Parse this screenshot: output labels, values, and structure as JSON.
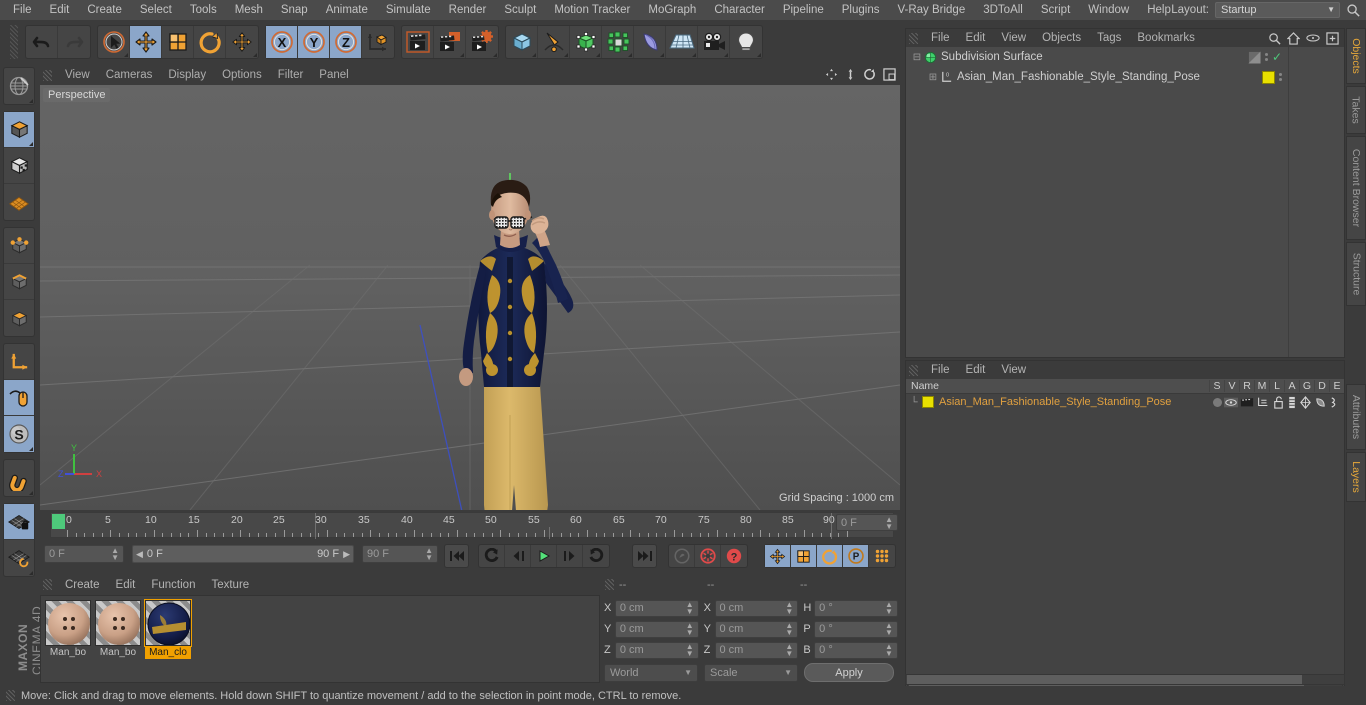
{
  "menubar": {
    "items": [
      "File",
      "Edit",
      "Create",
      "Select",
      "Tools",
      "Mesh",
      "Snap",
      "Animate",
      "Simulate",
      "Render",
      "Sculpt",
      "Motion Tracker",
      "MoGraph",
      "Character",
      "Pipeline",
      "Plugins",
      "V-Ray Bridge",
      "3DToAll",
      "Script",
      "Window",
      "Help"
    ],
    "layout_label": "Layout:",
    "layout_value": "Startup"
  },
  "toolbar": {
    "undo": "undo-arrow",
    "redo": "redo-arrow",
    "select": "selection-arrow",
    "move": "move-tool",
    "scale": "scale-tool",
    "rotate": "rotate-tool",
    "move2": "move-axis-tool",
    "axis_x": "X",
    "axis_y": "Y",
    "axis_z": "Z",
    "world_axis": "world-coordinate-system",
    "render_view": "render-view",
    "render_region": "render-region",
    "render_settings": "render-settings",
    "cube": "add-cube",
    "spline": "add-spline",
    "generator": "add-generator",
    "array": "add-array",
    "deformer": "add-deformer",
    "scene": "add-scene-object",
    "camera": "add-camera",
    "light": "add-light"
  },
  "left_toolbar": {
    "items": [
      "live-selection-globe-icon",
      "model-mode-icon",
      "texture-mode-icon",
      "polygon-grid-icon",
      "points-mode-icon",
      "edges-mode-icon",
      "polygons-mode-icon",
      "axis-mode-icon",
      "enable-axis-icon",
      "object-axis-icon",
      "magnet-icon",
      "workplane-lock-icon",
      "workplane-rotate-icon"
    ],
    "brand_line1": "MAXON",
    "brand_line2": "CINEMA 4D"
  },
  "viewport": {
    "menu": [
      "View",
      "Cameras",
      "Display",
      "Options",
      "Filter",
      "Panel"
    ],
    "perspective_label": "Perspective",
    "grid_spacing": "Grid Spacing : 1000 cm",
    "axis_x": "X",
    "axis_y": "Y",
    "axis_z": "Z",
    "icons": [
      "pan-icon",
      "zoom-icon",
      "rotate-icon",
      "maximize-icon"
    ]
  },
  "timeline": {
    "ticks": [
      "0",
      "5",
      "10",
      "15",
      "20",
      "25",
      "30",
      "35",
      "40",
      "45",
      "50",
      "55",
      "60",
      "65",
      "70",
      "75",
      "80",
      "85",
      "90"
    ],
    "current_frame_field": "0 F",
    "start_field": "0 F",
    "range_start": "0 F",
    "range_end": "90 F",
    "end_field": "90 F",
    "playback": [
      "go-to-start-icon",
      "play-backwards-icon",
      "step-back-icon",
      "play-icon",
      "step-forward-icon",
      "play-forward-icon",
      "go-to-end-icon"
    ],
    "record_tools": [
      "autokey-icon",
      "record-active-objects-icon",
      "record-help-icon"
    ],
    "key_tools": [
      "key-position-icon",
      "key-scale-icon",
      "key-rotation-icon",
      "key-parameter-icon",
      "key-point-icon",
      "animation-layer-icon"
    ]
  },
  "materials": {
    "menu": [
      "Create",
      "Edit",
      "Function",
      "Texture"
    ],
    "items": [
      {
        "name": "Man_bo",
        "selected": false,
        "color": "#c69a82"
      },
      {
        "name": "Man_bo",
        "selected": false,
        "color": "#c69a82"
      },
      {
        "name": "Man_clo",
        "selected": true,
        "color": "#1d2b5c"
      }
    ]
  },
  "coordinates": {
    "headers": [
      "--",
      "--",
      "--"
    ],
    "rows": [
      {
        "pos_label": "X",
        "pos_value": "0 cm",
        "size_label": "X",
        "size_value": "0 cm",
        "rot_label": "H",
        "rot_value": "0 °"
      },
      {
        "pos_label": "Y",
        "pos_value": "0 cm",
        "size_label": "Y",
        "size_value": "0 cm",
        "rot_label": "P",
        "rot_value": "0 °"
      },
      {
        "pos_label": "Z",
        "pos_value": "0 cm",
        "size_label": "Z",
        "size_value": "0 cm",
        "rot_label": "B",
        "rot_value": "0 °"
      }
    ],
    "system": "World",
    "mode": "Scale",
    "apply": "Apply"
  },
  "object_manager": {
    "menu": [
      "File",
      "Edit",
      "View",
      "Objects",
      "Tags",
      "Bookmarks"
    ],
    "icons": [
      "search-icon",
      "home-icon",
      "eye-icon",
      "new-layer-icon"
    ],
    "rows": [
      {
        "name": "Subdivision Surface",
        "indent": 0,
        "icon": "subdivision-surface-icon",
        "enabled": "✓"
      },
      {
        "name": "Asian_Man_Fashionable_Style_Standing_Pose",
        "indent": 1,
        "icon": "null-object-icon",
        "tag_color": "#e8e000"
      }
    ]
  },
  "layer_manager": {
    "menu": [
      "File",
      "Edit",
      "View"
    ],
    "columns": [
      "Name",
      "S",
      "V",
      "R",
      "M",
      "L",
      "A",
      "G",
      "D",
      "E"
    ],
    "rows": [
      {
        "name": "Asian_Man_Fashionable_Style_Standing_Pose",
        "color": "#e8e000"
      }
    ]
  },
  "right_tabs": {
    "top": [
      {
        "label": "Objects",
        "active": true
      },
      {
        "label": "Takes",
        "active": false
      },
      {
        "label": "Content Browser",
        "active": false
      },
      {
        "label": "Structure",
        "active": false
      }
    ],
    "bottom": [
      {
        "label": "Attributes",
        "active": false
      },
      {
        "label": "Layers",
        "active": true
      }
    ]
  },
  "status_bar": {
    "message": "Move: Click and drag to move elements. Hold down SHIFT to quantize movement / add to the selection in point mode, CTRL to remove."
  }
}
